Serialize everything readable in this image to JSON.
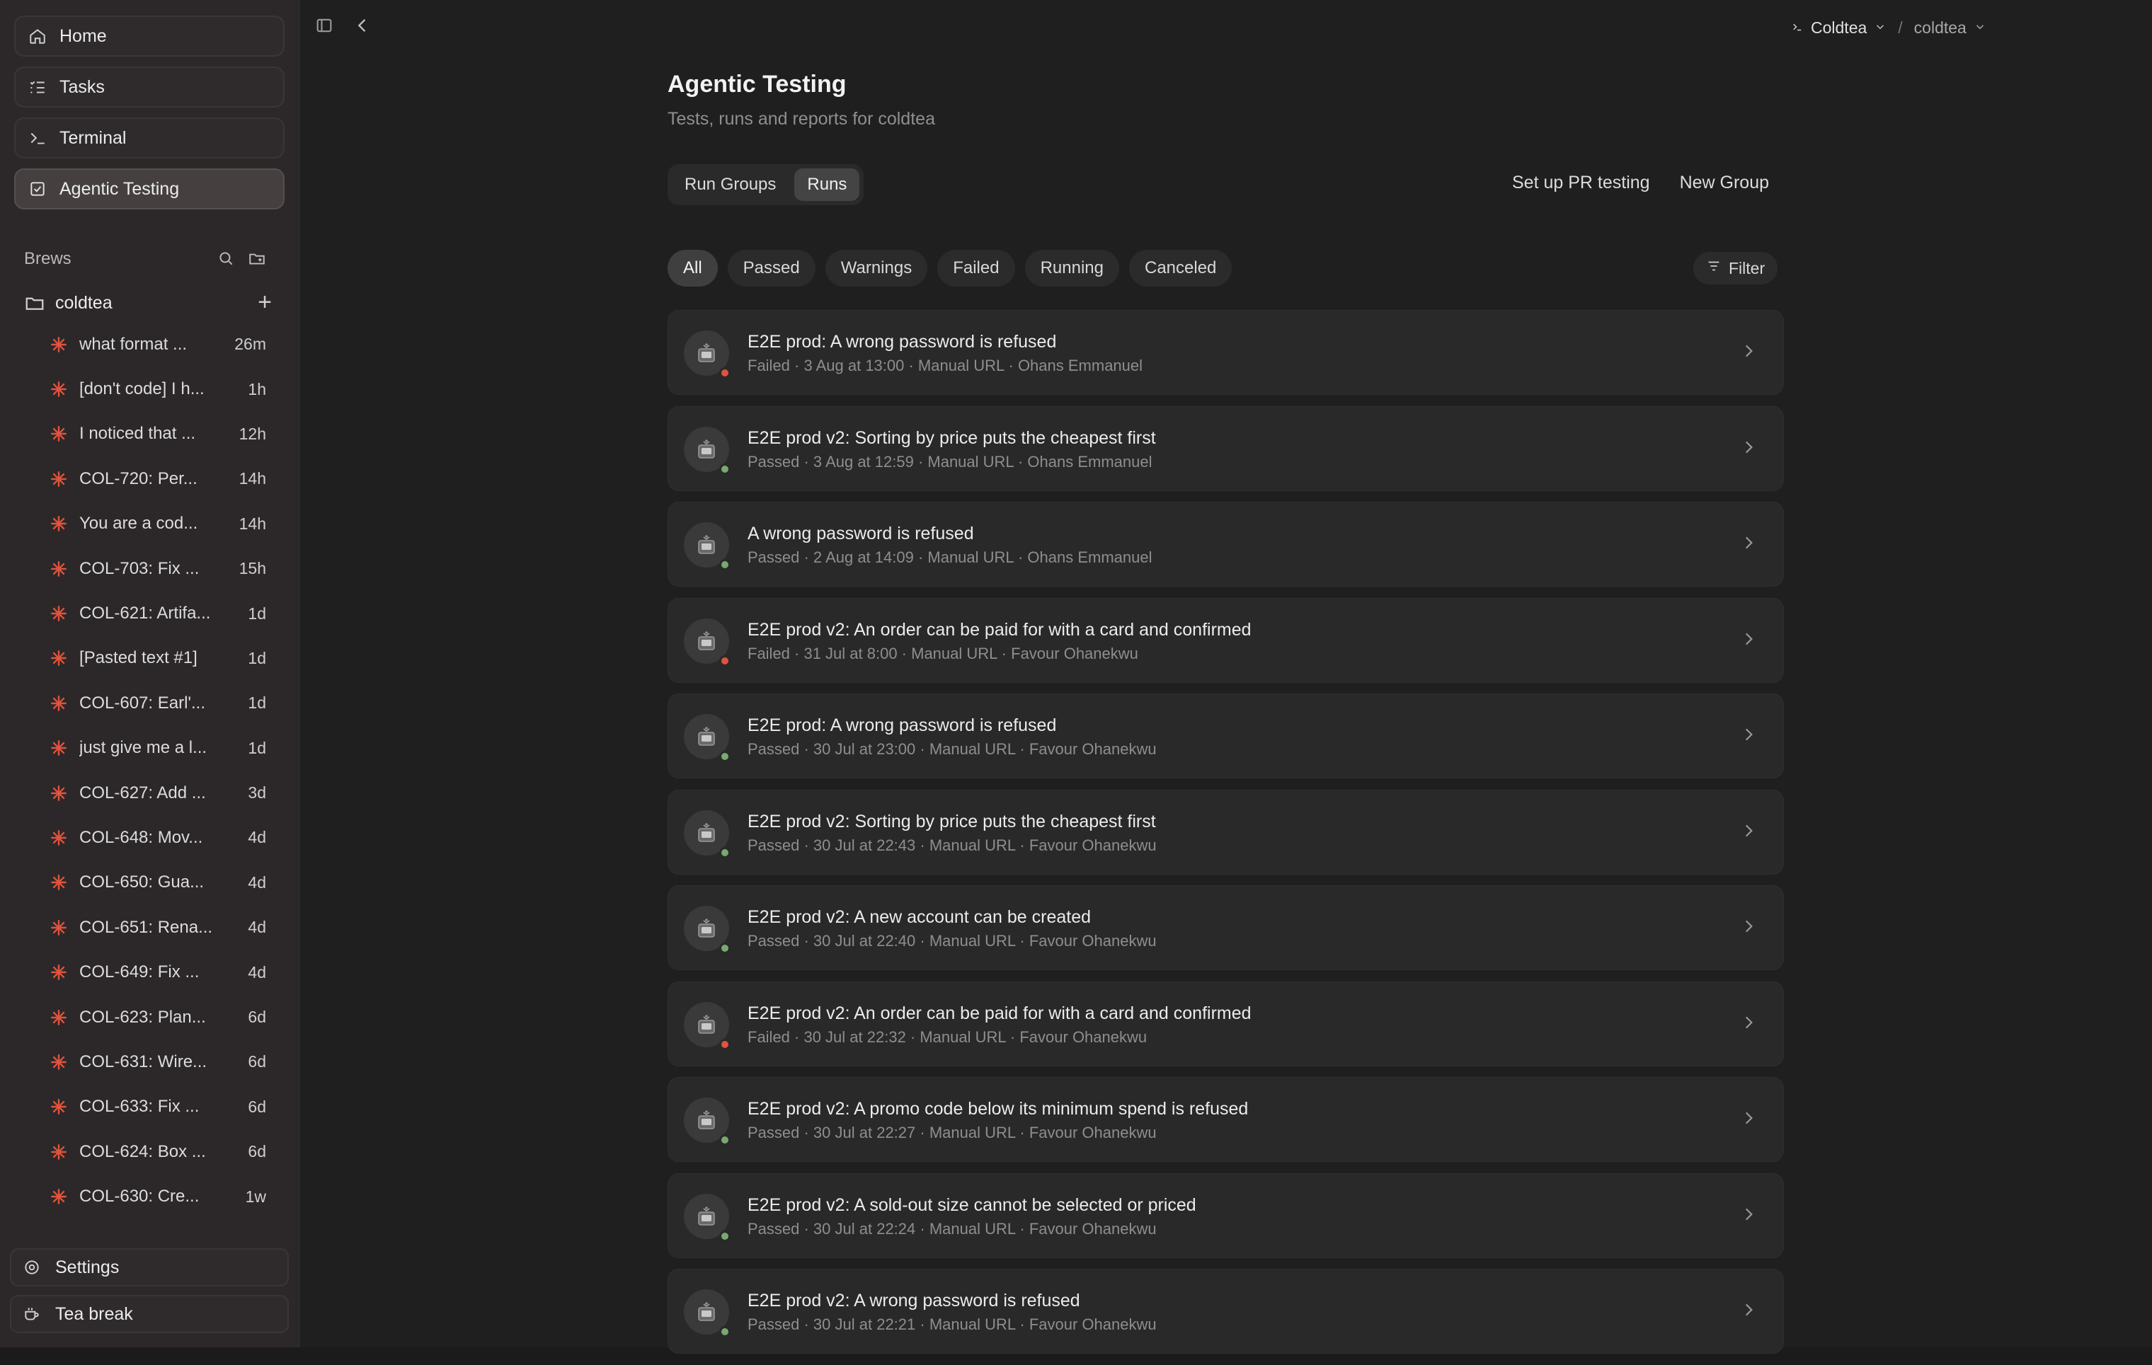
{
  "nav": [
    {
      "label": "Home",
      "icon": "home-icon"
    },
    {
      "label": "Tasks",
      "icon": "tasks-icon"
    },
    {
      "label": "Terminal",
      "icon": "terminal-icon"
    },
    {
      "label": "Agentic Testing",
      "icon": "checkbox-icon",
      "active": true
    }
  ],
  "brews_label": "Brews",
  "folder": "coldtea",
  "brews": [
    {
      "title": "what format ...",
      "age": "26m"
    },
    {
      "title": "[don't code] I h...",
      "age": "1h"
    },
    {
      "title": "I noticed that ...",
      "age": "12h"
    },
    {
      "title": "COL-720: Per...",
      "age": "14h"
    },
    {
      "title": "You are a cod...",
      "age": "14h"
    },
    {
      "title": "COL-703: Fix ...",
      "age": "15h"
    },
    {
      "title": "COL-621: Artifa...",
      "age": "1d"
    },
    {
      "title": "[Pasted text #1]",
      "age": "1d"
    },
    {
      "title": "COL-607: Earl'...",
      "age": "1d"
    },
    {
      "title": "just give me a l...",
      "age": "1d"
    },
    {
      "title": "COL-627: Add ...",
      "age": "3d"
    },
    {
      "title": "COL-648: Mov...",
      "age": "4d"
    },
    {
      "title": "COL-650: Gua...",
      "age": "4d"
    },
    {
      "title": "COL-651: Rena...",
      "age": "4d"
    },
    {
      "title": "COL-649: Fix ...",
      "age": "4d"
    },
    {
      "title": "COL-623: Plan...",
      "age": "6d"
    },
    {
      "title": "COL-631: Wire...",
      "age": "6d"
    },
    {
      "title": "COL-633: Fix ...",
      "age": "6d"
    },
    {
      "title": "COL-624: Box ...",
      "age": "6d"
    },
    {
      "title": "COL-630: Cre...",
      "age": "1w"
    }
  ],
  "bottom": {
    "settings": "Settings",
    "tea_break": "Tea break"
  },
  "workspace": {
    "org": "Coldtea",
    "separator": "/",
    "project": "coldtea"
  },
  "page": {
    "title": "Agentic Testing",
    "subtitle": "Tests, runs and reports for coldtea",
    "segments": [
      "Run Groups",
      "Runs"
    ],
    "selected_segment": "Runs",
    "actions": [
      "Set up PR testing",
      "New Group"
    ],
    "chips": [
      "All",
      "Passed",
      "Warnings",
      "Failed",
      "Running",
      "Canceled"
    ],
    "selected_chip": "All",
    "filter": "Filter"
  },
  "colors": {
    "failed": "#e0533d",
    "passed": "#7aa870",
    "accent_star": "#e0533d"
  },
  "runs": [
    {
      "title": "E2E prod: A wrong password is refused",
      "meta": "Failed · 3 Aug at 13:00 · Manual URL · Ohans Emmanuel",
      "status": "failed"
    },
    {
      "title": "E2E prod v2: Sorting by price puts the cheapest first",
      "meta": "Passed · 3 Aug at 12:59 · Manual URL · Ohans Emmanuel",
      "status": "passed"
    },
    {
      "title": "A wrong password is refused",
      "meta": "Passed · 2 Aug at 14:09 · Manual URL · Ohans Emmanuel",
      "status": "passed"
    },
    {
      "title": "E2E prod v2: An order can be paid for with a card and confirmed",
      "meta": "Failed · 31 Jul at 8:00 · Manual URL · Favour Ohanekwu",
      "status": "failed"
    },
    {
      "title": "E2E prod: A wrong password is refused",
      "meta": "Passed · 30 Jul at 23:00 · Manual URL · Favour Ohanekwu",
      "status": "passed"
    },
    {
      "title": "E2E prod v2: Sorting by price puts the cheapest first",
      "meta": "Passed · 30 Jul at 22:43 · Manual URL · Favour Ohanekwu",
      "status": "passed"
    },
    {
      "title": "E2E prod v2: A new account can be created",
      "meta": "Passed · 30 Jul at 22:40 · Manual URL · Favour Ohanekwu",
      "status": "passed"
    },
    {
      "title": "E2E prod v2: An order can be paid for with a card and confirmed",
      "meta": "Failed · 30 Jul at 22:32 · Manual URL · Favour Ohanekwu",
      "status": "failed"
    },
    {
      "title": "E2E prod v2: A promo code below its minimum spend is refused",
      "meta": "Passed · 30 Jul at 22:27 · Manual URL · Favour Ohanekwu",
      "status": "passed"
    },
    {
      "title": "E2E prod v2: A sold-out size cannot be selected or priced",
      "meta": "Passed · 30 Jul at 22:24 · Manual URL · Favour Ohanekwu",
      "status": "passed"
    },
    {
      "title": "E2E prod v2: A wrong password is refused",
      "meta": "Passed · 30 Jul at 22:21 · Manual URL · Favour Ohanekwu",
      "status": "passed"
    }
  ]
}
